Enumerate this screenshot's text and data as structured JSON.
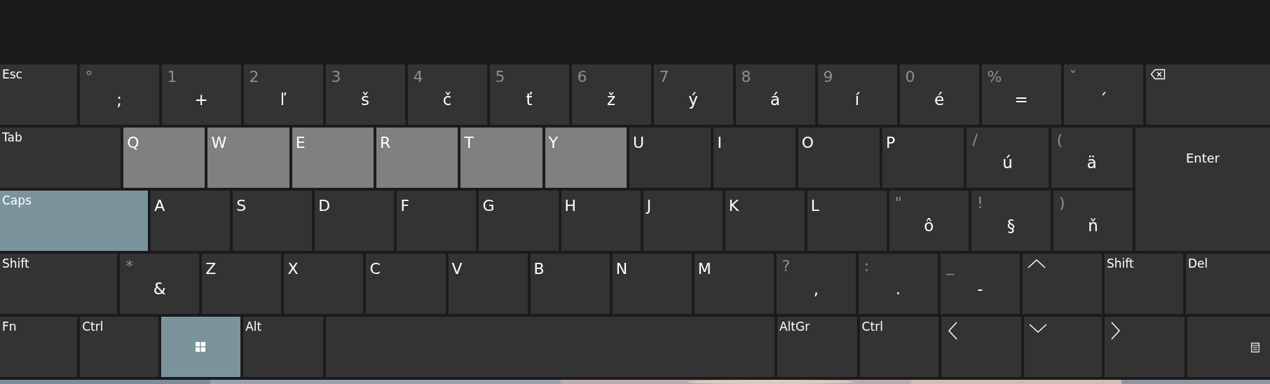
{
  "keyboard": {
    "rows": [
      {
        "keys": [
          {
            "kind": "func",
            "label": "Esc",
            "pressed": false,
            "on": false
          },
          {
            "kind": "char",
            "shift": "°",
            "label": ";",
            "pressed": false,
            "on": false
          },
          {
            "kind": "char",
            "shift": "1",
            "label": "+",
            "pressed": false,
            "on": false
          },
          {
            "kind": "char",
            "shift": "2",
            "label": "ľ",
            "pressed": false,
            "on": false
          },
          {
            "kind": "char",
            "shift": "3",
            "label": "š",
            "pressed": false,
            "on": false
          },
          {
            "kind": "char",
            "shift": "4",
            "label": "č",
            "pressed": false,
            "on": false
          },
          {
            "kind": "char",
            "shift": "5",
            "label": "ť",
            "pressed": false,
            "on": false
          },
          {
            "kind": "char",
            "shift": "6",
            "label": "ž",
            "pressed": false,
            "on": false
          },
          {
            "kind": "char",
            "shift": "7",
            "label": "ý",
            "pressed": false,
            "on": false
          },
          {
            "kind": "char",
            "shift": "8",
            "label": "á",
            "pressed": false,
            "on": false
          },
          {
            "kind": "char",
            "shift": "9",
            "label": "í",
            "pressed": false,
            "on": false
          },
          {
            "kind": "char",
            "shift": "0",
            "label": "é",
            "pressed": false,
            "on": false
          },
          {
            "kind": "char",
            "shift": "%",
            "label": "=",
            "pressed": false,
            "on": false
          },
          {
            "kind": "char",
            "shift": "ˇ",
            "label": "´",
            "pressed": false,
            "on": false
          },
          {
            "kind": "backspace",
            "pressed": false,
            "on": false
          }
        ]
      },
      {
        "keys": [
          {
            "kind": "func",
            "label": "Tab",
            "pressed": false,
            "on": false
          },
          {
            "kind": "letter",
            "label": "Q",
            "pressed": true,
            "on": false
          },
          {
            "kind": "letter",
            "label": "W",
            "pressed": true,
            "on": false
          },
          {
            "kind": "letter",
            "label": "E",
            "pressed": true,
            "on": false
          },
          {
            "kind": "letter",
            "label": "R",
            "pressed": true,
            "on": false
          },
          {
            "kind": "letter",
            "label": "T",
            "pressed": true,
            "on": false
          },
          {
            "kind": "letter",
            "label": "Y",
            "pressed": true,
            "on": false
          },
          {
            "kind": "letter",
            "label": "U",
            "pressed": false,
            "on": false
          },
          {
            "kind": "letter",
            "label": "I",
            "pressed": false,
            "on": false
          },
          {
            "kind": "letter",
            "label": "O",
            "pressed": false,
            "on": false
          },
          {
            "kind": "letter",
            "label": "P",
            "pressed": false,
            "on": false
          },
          {
            "kind": "char",
            "shift": "/",
            "label": "ú",
            "pressed": false,
            "on": false
          },
          {
            "kind": "char",
            "shift": "(",
            "label": "ä",
            "pressed": false,
            "on": false
          },
          {
            "kind": "enter",
            "label": "Enter",
            "pressed": false,
            "on": false
          }
        ]
      },
      {
        "keys": [
          {
            "kind": "func",
            "label": "Caps",
            "pressed": false,
            "on": true
          },
          {
            "kind": "letter",
            "label": "A",
            "pressed": false,
            "on": false
          },
          {
            "kind": "letter",
            "label": "S",
            "pressed": false,
            "on": false
          },
          {
            "kind": "letter",
            "label": "D",
            "pressed": false,
            "on": false
          },
          {
            "kind": "letter",
            "label": "F",
            "pressed": false,
            "on": false
          },
          {
            "kind": "letter",
            "label": "G",
            "pressed": false,
            "on": false
          },
          {
            "kind": "letter",
            "label": "H",
            "pressed": false,
            "on": false
          },
          {
            "kind": "letter",
            "label": "J",
            "pressed": false,
            "on": false
          },
          {
            "kind": "letter",
            "label": "K",
            "pressed": false,
            "on": false
          },
          {
            "kind": "letter",
            "label": "L",
            "pressed": false,
            "on": false
          },
          {
            "kind": "char",
            "shift": "\"",
            "label": "ô",
            "pressed": false,
            "on": false
          },
          {
            "kind": "char",
            "shift": "!",
            "label": "§",
            "pressed": false,
            "on": false
          },
          {
            "kind": "char",
            "shift": ")",
            "label": "ň",
            "pressed": false,
            "on": false
          }
        ]
      },
      {
        "keys": [
          {
            "kind": "func",
            "label": "Shift",
            "pressed": false,
            "on": false
          },
          {
            "kind": "char",
            "shift": "*",
            "label": "&",
            "pressed": false,
            "on": false
          },
          {
            "kind": "letter",
            "label": "Z",
            "pressed": false,
            "on": false
          },
          {
            "kind": "letter",
            "label": "X",
            "pressed": false,
            "on": false
          },
          {
            "kind": "letter",
            "label": "C",
            "pressed": false,
            "on": false
          },
          {
            "kind": "letter",
            "label": "V",
            "pressed": false,
            "on": false
          },
          {
            "kind": "letter",
            "label": "B",
            "pressed": false,
            "on": false
          },
          {
            "kind": "letter",
            "label": "N",
            "pressed": false,
            "on": false
          },
          {
            "kind": "letter",
            "label": "M",
            "pressed": false,
            "on": false
          },
          {
            "kind": "char",
            "shift": "?",
            "label": ",",
            "pressed": false,
            "on": false
          },
          {
            "kind": "char",
            "shift": ":",
            "label": ".",
            "pressed": false,
            "on": false
          },
          {
            "kind": "char",
            "shift": "_",
            "label": "-",
            "pressed": false,
            "on": false
          },
          {
            "kind": "up",
            "pressed": false,
            "on": false
          },
          {
            "kind": "func",
            "label": "Shift",
            "pressed": false,
            "on": false
          },
          {
            "kind": "func",
            "label": "Del",
            "pressed": false,
            "on": false
          }
        ]
      },
      {
        "keys": [
          {
            "kind": "func",
            "label": "Fn",
            "pressed": false,
            "on": false
          },
          {
            "kind": "func",
            "label": "Ctrl",
            "pressed": false,
            "on": false
          },
          {
            "kind": "windows",
            "pressed": false,
            "on": true
          },
          {
            "kind": "func",
            "label": "Alt",
            "pressed": false,
            "on": false
          },
          {
            "kind": "space",
            "pressed": false,
            "on": false
          },
          {
            "kind": "func",
            "label": "AltGr",
            "pressed": false,
            "on": false
          },
          {
            "kind": "func",
            "label": "Ctrl",
            "pressed": false,
            "on": false
          },
          {
            "kind": "left",
            "pressed": false,
            "on": false
          },
          {
            "kind": "down",
            "pressed": false,
            "on": false
          },
          {
            "kind": "right",
            "pressed": false,
            "on": false
          },
          {
            "kind": "menu",
            "pressed": false,
            "on": false
          }
        ]
      }
    ]
  }
}
